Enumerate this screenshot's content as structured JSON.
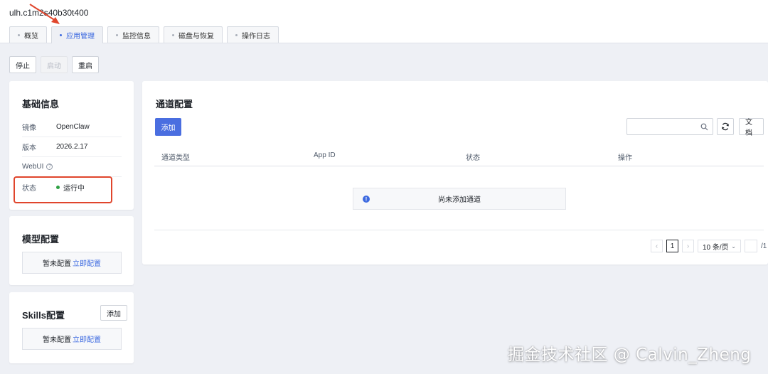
{
  "instance_title": "ulh.c1m2s40b30t400",
  "tabs": [
    {
      "label": "概览"
    },
    {
      "label": "应用管理",
      "active": true
    },
    {
      "label": "监控信息"
    },
    {
      "label": "磁盘与恢复"
    },
    {
      "label": "操作日志"
    }
  ],
  "actions": {
    "stop": "停止",
    "start": "启动",
    "restart": "重启"
  },
  "basic_info": {
    "title": "基础信息",
    "image_label": "镜像",
    "image_value": "OpenClaw",
    "version_label": "版本",
    "version_value": "2026.2.17",
    "webui_label": "WebUI",
    "status_label": "状态",
    "status_value": "运行中"
  },
  "model_config": {
    "title": "模型配置",
    "empty_text": "暂未配置",
    "link": "立即配置"
  },
  "skills_config": {
    "title": "Skills配置",
    "add": "添加",
    "empty_text": "暂未配置",
    "link": "立即配置"
  },
  "channel_config": {
    "title": "通道配置",
    "add": "添加",
    "docs": "文档",
    "columns": [
      "通道类型",
      "App ID",
      "状态",
      "操作"
    ],
    "empty_text": "尚未添加通道",
    "pagination": {
      "current_page": "1",
      "page_size": "10 条/页",
      "total_pages": "/1"
    }
  },
  "watermark": "掘金技术社区 @ Calvin_Zheng",
  "colors": {
    "accent": "#3d6ae0",
    "primary_button": "#4a6ee0",
    "running": "#2ea043",
    "highlight_box": "#e0452c",
    "arrow": "#e0452c"
  }
}
